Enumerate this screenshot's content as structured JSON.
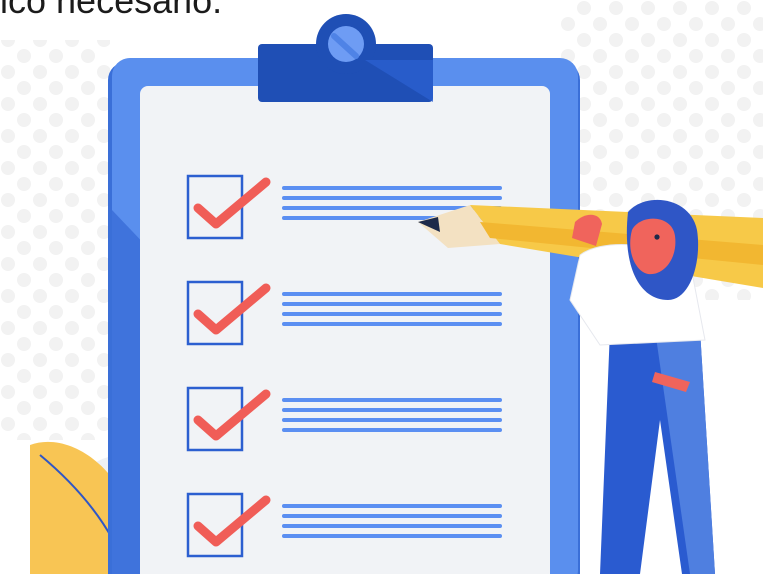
{
  "caption": {
    "text": "ico necesario."
  },
  "illustration": {
    "checklist": {
      "item_count": 4,
      "all_checked": true
    },
    "colors": {
      "board_blue": "#4f83e6",
      "board_blue_dark": "#3a6fd8",
      "paper": "#f1f3f6",
      "clip": "#1f4fb5",
      "check_mark": "#f05d57",
      "line_blue": "#5b8ff2",
      "pencil_yellow": "#f7c948",
      "hair": "#2f56c6",
      "skin": "#f0645c",
      "pants": "#2a5bd0",
      "leaf": "#f8c554",
      "background_dots": "#f0f0f0"
    }
  }
}
